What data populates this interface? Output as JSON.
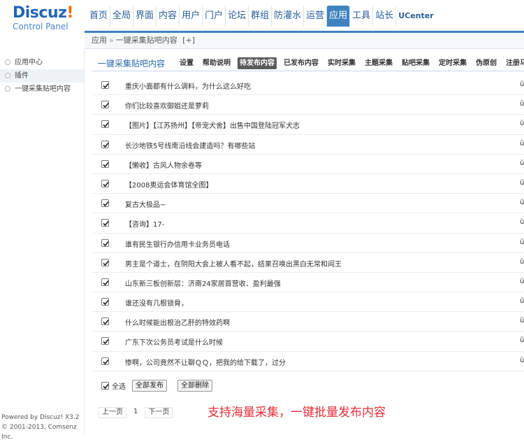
{
  "logo": {
    "word": "Discuz",
    "bang": "!",
    "subtitle": "Control Panel"
  },
  "nav": [
    {
      "label": "首页"
    },
    {
      "label": "全局"
    },
    {
      "label": "界面"
    },
    {
      "label": "内容"
    },
    {
      "label": "用户"
    },
    {
      "label": "门户"
    },
    {
      "label": "论坛"
    },
    {
      "label": "群组"
    },
    {
      "label": "防灌水"
    },
    {
      "label": "运营"
    },
    {
      "label": "应用",
      "active": true
    },
    {
      "label": "工具"
    },
    {
      "label": "站长"
    },
    {
      "label": "UCenter"
    }
  ],
  "breadcrumb": {
    "root": "应用",
    "sep": "»",
    "current": "一键采集贴吧内容",
    "extra": "[+]"
  },
  "sidebar": {
    "items": [
      {
        "label": "应用中心"
      },
      {
        "label": "插件",
        "active": true
      },
      {
        "label": "一键采集贴吧内容"
      }
    ],
    "powered": "Powered by Discuz! X3.2",
    "copyright": "© 2001-2013, Comsenz Inc."
  },
  "plugin": {
    "title": "一键采集贴吧内容",
    "tabs": [
      {
        "label": "设置"
      },
      {
        "label": "帮助说明"
      },
      {
        "label": "待发布内容",
        "active": true
      },
      {
        "label": "已发布内容"
      },
      {
        "label": "实时采集"
      },
      {
        "label": "主题采集"
      },
      {
        "label": "贴吧采集"
      },
      {
        "label": "定时采集"
      },
      {
        "label": "伪原创"
      },
      {
        "label": "注册马甲"
      }
    ]
  },
  "rows": [
    {
      "title": "重庆小面都有什么调料，为什么这么好吃",
      "checked": true,
      "edge": "ü"
    },
    {
      "title": "你们比较喜欢御姐还是萝莉",
      "checked": true,
      "edge": "ü"
    },
    {
      "title": "【图片】【江苏扬州】【帝宠犬舍】出售中国登陆冠军犬志",
      "checked": true,
      "edge": "ü"
    },
    {
      "title": "长沙地铁5号线南沿线会建造吗？有哪些站",
      "checked": true,
      "edge": "ü"
    },
    {
      "title": "【懒收】古风人物余卷等",
      "checked": true,
      "edge": "ü"
    },
    {
      "title": "【2008奥运会体育馆全图】",
      "checked": true,
      "edge": "ü"
    },
    {
      "title": "复古大极品~",
      "checked": true,
      "edge": "ü"
    },
    {
      "title": "【咨询】17-",
      "checked": true,
      "edge": "ü"
    },
    {
      "title": "谁有民生银行办信用卡业务员电话",
      "checked": true,
      "edge": "ü"
    },
    {
      "title": "男主是个道士，在阴阳大会上被人看不起，结果召唤出黑白无常和阎王",
      "checked": true,
      "edge": "ü"
    },
    {
      "title": "山东新三板创新层：济南24家居首营收、盈利最强",
      "checked": true,
      "edge": "ü"
    },
    {
      "title": "谁还没有几根锁骨，",
      "checked": true,
      "edge": "ü"
    },
    {
      "title": "什么时候能出根治乙肝的特效药啊",
      "checked": true,
      "edge": "ü"
    },
    {
      "title": "广东下次公务员考试是什么时候",
      "checked": true,
      "edge": "ü"
    },
    {
      "title": "惨啊，公司竟然不让聊ＱＱ，把我的给下载了，过分",
      "checked": true,
      "edge": "ü"
    }
  ],
  "bulk": {
    "select_all": "全选",
    "select_all_checked": true,
    "publish_all": "全部发布",
    "delete_all": "全部删除"
  },
  "pager": {
    "prev": "上一页",
    "current": "1",
    "next": "下一页"
  },
  "promo": "支持海量采集，一键批量发布内容",
  "colors": {
    "accent": "#3f82c0",
    "link": "#2a5c9a",
    "promo": "#e62f3a",
    "logo_blue": "#2266b8",
    "logo_orange": "#f26c00"
  }
}
